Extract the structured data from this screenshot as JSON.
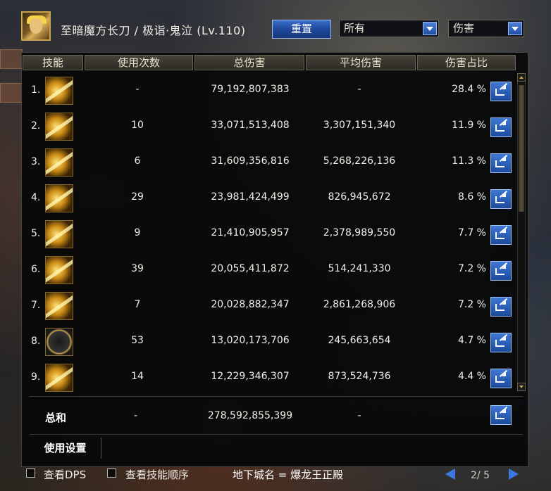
{
  "header": {
    "title": "至暗魔方长刀 / 极诣·鬼泣 (Lv.110)",
    "reset_label": "重置",
    "filter_select": "所有",
    "metric_select": "伤害"
  },
  "columns": {
    "skill": "技能",
    "uses": "使用次数",
    "total": "总伤害",
    "avg": "平均伤害",
    "pct": "伤害占比"
  },
  "rows": [
    {
      "rank": "1.",
      "uses": "-",
      "total": "79,192,807,383",
      "avg": "-",
      "pct": "28.4 %"
    },
    {
      "rank": "2.",
      "uses": "10",
      "total": "33,071,513,408",
      "avg": "3,307,151,340",
      "pct": "11.9 %"
    },
    {
      "rank": "3.",
      "uses": "6",
      "total": "31,609,356,816",
      "avg": "5,268,226,136",
      "pct": "11.3 %"
    },
    {
      "rank": "4.",
      "uses": "29",
      "total": "23,981,424,499",
      "avg": "826,945,672",
      "pct": "8.6 %"
    },
    {
      "rank": "5.",
      "uses": "9",
      "total": "21,410,905,957",
      "avg": "2,378,989,550",
      "pct": "7.7 %"
    },
    {
      "rank": "6.",
      "uses": "39",
      "total": "20,055,411,872",
      "avg": "514,241,330",
      "pct": "7.2 %"
    },
    {
      "rank": "7.",
      "uses": "7",
      "total": "20,028,882,347",
      "avg": "2,861,268,906",
      "pct": "7.2 %"
    },
    {
      "rank": "8.",
      "uses": "53",
      "total": "13,020,173,706",
      "avg": "245,663,654",
      "pct": "4.7 %"
    },
    {
      "rank": "9.",
      "uses": "14",
      "total": "12,229,346,307",
      "avg": "873,524,736",
      "pct": "4.4 %"
    }
  ],
  "summary": {
    "label": "总和",
    "uses": "-",
    "total": "278,592,855,399",
    "avg": "-"
  },
  "settings_tab": "使用设置",
  "footer": {
    "view_dps": "查看DPS",
    "view_order": "查看技能顺序",
    "dungeon": "地下城名 = 爆龙王正殿",
    "page": "2/ 5"
  }
}
